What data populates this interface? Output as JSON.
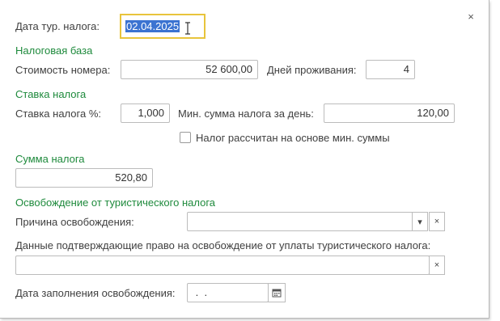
{
  "form": {
    "close_glyph": "×",
    "tour_tax_date": {
      "label": "Дата тур. налога:",
      "value": "02.04.2025"
    },
    "tax_base": {
      "title": "Налоговая база",
      "room_cost_label": "Стоимость номера:",
      "room_cost_value": "52 600,00",
      "days_label": "Дней проживания:",
      "days_value": "4"
    },
    "tax_rate": {
      "title": "Ставка налога",
      "rate_label": "Ставка налога %:",
      "rate_value": "1,000",
      "min_per_day_label": "Мин. сумма налога за день:",
      "min_per_day_value": "120,00",
      "min_checkbox_label": "Налог рассчитан на основе мин. суммы",
      "min_checkbox_checked": false
    },
    "tax_sum": {
      "title": "Сумма налога",
      "value": "520,80"
    },
    "exemption": {
      "title": "Освобождение от туристического налога",
      "reason_label": "Причина освобождения:",
      "reason_value": "",
      "dropdown_glyph": "▾",
      "clear_glyph": "×",
      "proof_label": "Данные подтверждающие право на освобождение от уплаты туристического налога:",
      "proof_value": "",
      "fill_date_label": "Дата заполнения освобождения:",
      "fill_date_value": " .  . ",
      "calendar_icon": "calendar-icon"
    }
  },
  "colors": {
    "section_title": "#1e8a3c",
    "focus_border": "#e8c43c",
    "selection": "#3b73d1"
  }
}
